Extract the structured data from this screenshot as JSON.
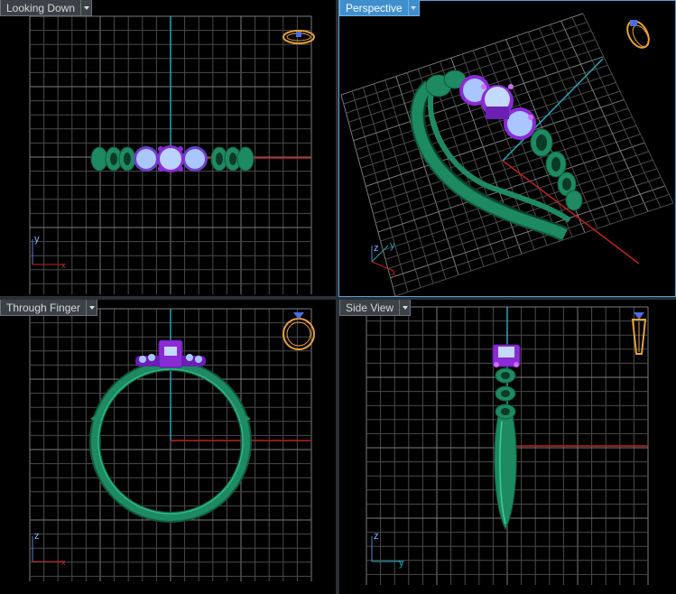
{
  "viewports": {
    "top_left": {
      "label": "Looking Down",
      "active": false
    },
    "top_right": {
      "label": "Perspective",
      "active": true
    },
    "bottom_left": {
      "label": "Through Finger",
      "active": false
    },
    "bottom_right": {
      "label": "Side View",
      "active": false
    }
  },
  "axes": {
    "looking_down": {
      "a": "y",
      "b": "x"
    },
    "perspective": {
      "a": "z",
      "b": "y",
      "c": "x"
    },
    "through_finger": {
      "a": "z",
      "b": "x"
    },
    "side_view": {
      "a": "z",
      "b": "y"
    }
  },
  "colors": {
    "grid": "#6a6a6a",
    "ring_metal": "#1e8a62",
    "gem": "#a9c6ff",
    "prong": "#8a2bd6",
    "x_axis": "#c0221c",
    "y_axis": "#27a6b8",
    "nav_cube": "#e8a23a"
  }
}
